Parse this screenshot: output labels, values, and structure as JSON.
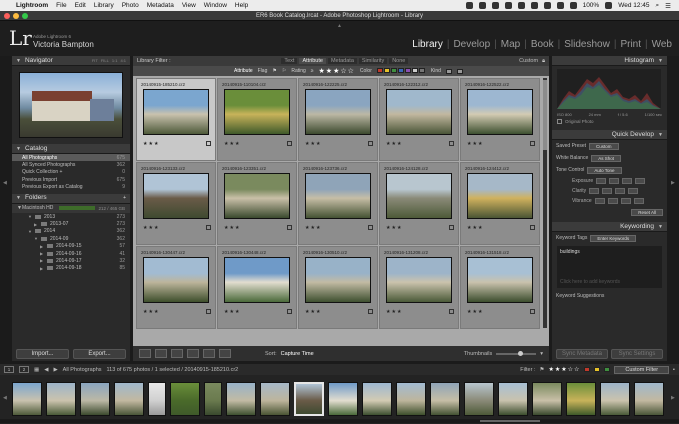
{
  "menubar": {
    "items": [
      "Lightroom",
      "File",
      "Edit",
      "Library",
      "Photo",
      "Metadata",
      "View",
      "Window",
      "Help"
    ],
    "battery": "100%",
    "time": "Wed 12:45"
  },
  "window_title": "ER6 Book Catalog.lrcat - Adobe Photoshop Lightroom - Library",
  "identity": {
    "logo": "Lr",
    "product": "Adobe Lightroom 6",
    "name": "Victoria Bampton"
  },
  "modules": [
    "Library",
    "Develop",
    "Map",
    "Book",
    "Slideshow",
    "Print",
    "Web"
  ],
  "navigator": {
    "title": "Navigator",
    "zoom_options": [
      "FIT",
      "FILL",
      "1:1",
      "4:1"
    ]
  },
  "catalog": {
    "title": "Catalog",
    "items": [
      {
        "label": "All Photographs",
        "count": "675"
      },
      {
        "label": "All Synced Photographs",
        "count": "362"
      },
      {
        "label": "Quick Collection +",
        "count": "0"
      },
      {
        "label": "Previous Import",
        "count": "675"
      },
      {
        "label": "Previous Export as Catalog",
        "count": "9"
      }
    ]
  },
  "folders": {
    "title": "Folders",
    "volume": {
      "label": "Macintosh HD",
      "count": "212 / 465 GB"
    },
    "items": [
      {
        "label": "2013",
        "count": "273"
      },
      {
        "label": "2013-07",
        "count": "273"
      },
      {
        "label": "2014",
        "count": "362"
      },
      {
        "label": "2014-09",
        "count": "362"
      },
      {
        "label": "2014-09-15",
        "count": "57"
      },
      {
        "label": "2014-09-16",
        "count": "41"
      },
      {
        "label": "2014-09-17",
        "count": "32"
      },
      {
        "label": "2014-09-18",
        "count": "85"
      }
    ]
  },
  "left_buttons": {
    "import": "Import...",
    "export": "Export..."
  },
  "filter_bar": {
    "title": "Library Filter :",
    "tabs": [
      "Text",
      "Attribute",
      "Metadata",
      "Similarity",
      "None"
    ],
    "custom": "Custom"
  },
  "attribute_bar": {
    "label": "Attribute",
    "flag": "Flag",
    "rating_label": "Rating",
    "rating_op": "≥",
    "stars": "★★★☆☆",
    "color_label": "Color",
    "kind_label": "Kind",
    "swatch_colors": [
      "#c0392b",
      "#e6c229",
      "#3f8f3f",
      "#3a66b8",
      "#8a4fb0",
      "#cccccc",
      "#777777"
    ]
  },
  "grid": {
    "cells": [
      {
        "file": "20140915-185210.cr2",
        "stars": "★★★",
        "colors": [
          "#7ba6cf",
          "#c9c2ae",
          "#4e5a3a"
        ]
      },
      {
        "file": "20140915-110104.cr2",
        "stars": "★★★",
        "colors": [
          "#6a8e3a",
          "#c8b35a",
          "#3f5a2a"
        ]
      },
      {
        "file": "20140916-122225.cr2",
        "stars": "★★★",
        "colors": [
          "#8aa5c0",
          "#bcb8a5",
          "#3c4a2e"
        ]
      },
      {
        "file": "20140916-122312.cr2",
        "stars": "★★★",
        "colors": [
          "#a0b8cc",
          "#c2b8a0",
          "#4a5638"
        ]
      },
      {
        "file": "20140916-122522.cr2",
        "stars": "★★★",
        "colors": [
          "#9db7d1",
          "#d3cbb3",
          "#3d5030"
        ]
      },
      {
        "file": "20140916-123133.cr2",
        "stars": "★★★",
        "colors": [
          "#b0c4d6",
          "#6a5b48",
          "#3e4a30"
        ]
      },
      {
        "file": "20140916-123351.cr2",
        "stars": "★★★",
        "colors": [
          "#7a8a5e",
          "#c9c0a8",
          "#3a4a2e"
        ]
      },
      {
        "file": "20140916-123736.cr2",
        "stars": "★★★",
        "colors": [
          "#8fa4b8",
          "#c6bea6",
          "#445233"
        ]
      },
      {
        "file": "20140916-124128.cr2",
        "stars": "★★★",
        "colors": [
          "#b8c6cf",
          "#8a8a78",
          "#4d5a38"
        ]
      },
      {
        "file": "20140916-124412.cr2",
        "stars": "★★★",
        "colors": [
          "#a6b8c8",
          "#d0b25e",
          "#4a5534"
        ]
      },
      {
        "file": "20140916-130447.cr2",
        "stars": "★★★",
        "colors": [
          "#a2bbd2",
          "#bdb59c",
          "#3e4f2c"
        ]
      },
      {
        "file": "20140916-130448.cr2",
        "stars": "★★★",
        "colors": [
          "#6f9ac8",
          "#e2ddcf",
          "#4a6a3a"
        ]
      },
      {
        "file": "20140916-130510.cr2",
        "stars": "★★★",
        "colors": [
          "#98b2c8",
          "#c2bba4",
          "#3e5030"
        ]
      },
      {
        "file": "20140916-131208.cr2",
        "stars": "★★★",
        "colors": [
          "#9db4c9",
          "#cbc3ad",
          "#4a5a38"
        ]
      },
      {
        "file": "20140916-131518.cr2",
        "stars": "★★★",
        "colors": [
          "#a8c0d4",
          "#c9c2ad",
          "#3c4e2e"
        ]
      }
    ]
  },
  "toolbar": {
    "sort_label": "Sort:",
    "sort_value": "Capture Time",
    "thumbnails_label": "Thumbnails"
  },
  "histogram": {
    "title": "Histogram",
    "iso": "ISO 800",
    "focal": "24 mm",
    "aperture": "f / 5.6",
    "shutter": "1/100 sec",
    "original_photo": "Original Photo"
  },
  "quick_develop": {
    "title": "Quick Develop",
    "saved_preset_label": "Saved Preset",
    "saved_preset_value": "Custom",
    "white_balance_label": "White Balance",
    "white_balance_value": "As Shot",
    "tone_control_label": "Tone Control",
    "auto_tone": "Auto Tone",
    "exposure": "Exposure",
    "clarity": "Clarity",
    "vibrance": "Vibrance",
    "reset": "Reset All"
  },
  "keywording": {
    "title": "Keywording",
    "tags_label": "Keyword Tags",
    "tags_mode": "Enter Keywords",
    "keywords": "buildings",
    "hint": "Click here to add keywords",
    "suggestions": "Keyword Suggestions"
  },
  "right_buttons": {
    "sync_metadata": "Sync Metadata",
    "sync_settings": "Sync Settings"
  },
  "filmstrip_bar": {
    "monitor_1": "1",
    "monitor_2": "2",
    "source": "All Photographs",
    "info": "113 of 675 photos / 1 selected / 20140915-185210.cr2",
    "filter_label": "Filter :",
    "stars": "★★★☆☆",
    "custom_filter": "Custom Filter"
  },
  "filmstrip": {
    "frames": [
      {
        "w": 30,
        "colors": [
          "#7ba6cf",
          "#c9c2ae",
          "#4e5a3a"
        ]
      },
      {
        "w": 30,
        "colors": [
          "#9db4c9",
          "#cbc3ad",
          "#4a5a38"
        ]
      },
      {
        "w": 30,
        "colors": [
          "#8aa5c0",
          "#bcb8a5",
          "#3c4a2e"
        ]
      },
      {
        "w": 30,
        "colors": [
          "#a0b8cc",
          "#c2b8a0",
          "#4a5638"
        ]
      },
      {
        "w": 18,
        "colors": [
          "#e8e8e8",
          "#d0d0d0",
          "#9a9a9a"
        ]
      },
      {
        "w": 30,
        "colors": [
          "#6a8e3a",
          "#4a6a2a",
          "#3f5a2a"
        ]
      },
      {
        "w": 18,
        "colors": [
          "#7a8a5e",
          "#6a7a4e",
          "#3a4a2e"
        ]
      },
      {
        "w": 30,
        "colors": [
          "#98b2c8",
          "#c2bba4",
          "#3e5030"
        ]
      },
      {
        "w": 30,
        "colors": [
          "#a6b8c8",
          "#bdb59c",
          "#4a5534"
        ]
      },
      {
        "w": 30,
        "colors": [
          "#b0c4d6",
          "#6a5b48",
          "#3e4a30"
        ]
      },
      {
        "w": 30,
        "colors": [
          "#6f9ac8",
          "#e2ddcf",
          "#4a6a3a"
        ]
      },
      {
        "w": 30,
        "colors": [
          "#9db7d1",
          "#d3cbb3",
          "#3d5030"
        ]
      },
      {
        "w": 30,
        "colors": [
          "#a2bbd2",
          "#bdb59c",
          "#3e4f2c"
        ]
      },
      {
        "w": 30,
        "colors": [
          "#8fa4b8",
          "#c6bea6",
          "#445233"
        ]
      },
      {
        "w": 30,
        "colors": [
          "#b8c6cf",
          "#8a8a78",
          "#4d5a38"
        ]
      },
      {
        "w": 30,
        "colors": [
          "#a8c0d4",
          "#c9c2ad",
          "#3c4e2e"
        ]
      },
      {
        "w": 30,
        "colors": [
          "#7a8a5e",
          "#c9c0a8",
          "#3a4a2e"
        ]
      },
      {
        "w": 30,
        "colors": [
          "#6a8e3a",
          "#c8b35a",
          "#3f5a2a"
        ]
      },
      {
        "w": 30,
        "colors": [
          "#9db4c9",
          "#cbc3ad",
          "#4a5a38"
        ]
      },
      {
        "w": 30,
        "colors": [
          "#a0b8cc",
          "#c2b8a0",
          "#4a5638"
        ]
      }
    ]
  }
}
